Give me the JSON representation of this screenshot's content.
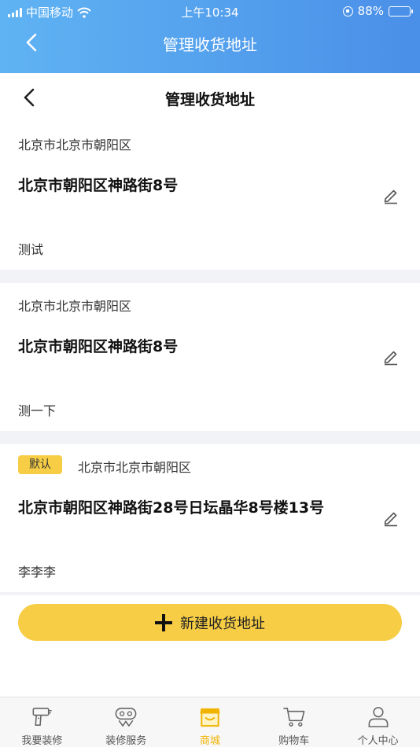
{
  "status_bar": {
    "carrier": "中国移动",
    "time": "上午10:34",
    "battery": "88%",
    "battery_level": 0.88
  },
  "header": {
    "title": "管理收货地址"
  },
  "sub_header": {
    "title": "管理收货地址"
  },
  "addresses": [
    {
      "default_label": "",
      "region": "北京市北京市朝阳区",
      "street": "北京市朝阳区神路街8号",
      "name": "测试"
    },
    {
      "default_label": "",
      "region": "北京市北京市朝阳区",
      "street": "北京市朝阳区神路街8号",
      "name": "测一下"
    },
    {
      "default_label": "默认",
      "region": "北京市北京市朝阳区",
      "street": "北京市朝阳区神路街28号日坛晶华8号楼13号",
      "name": "李李李"
    }
  ],
  "new_address_button": {
    "label": "新建收货地址"
  },
  "tabs": [
    {
      "label": "我要装修",
      "icon": "drill-icon",
      "active": false
    },
    {
      "label": "装修服务",
      "icon": "service-icon",
      "active": false
    },
    {
      "label": "商城",
      "icon": "shop-icon",
      "active": true
    },
    {
      "label": "购物车",
      "icon": "cart-icon",
      "active": false
    },
    {
      "label": "个人中心",
      "icon": "user-icon",
      "active": false
    }
  ],
  "colors": {
    "header_start": "#5fb3f3",
    "header_end": "#4a8fe8",
    "accent_yellow": "#f6cd45",
    "active_tab": "#f0b400"
  }
}
